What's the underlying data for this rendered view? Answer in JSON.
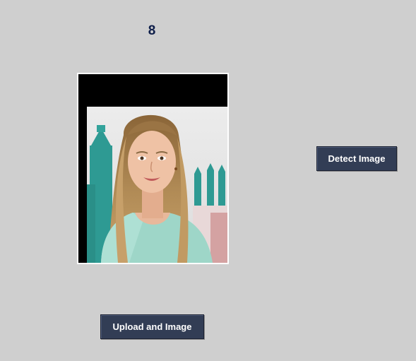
{
  "result": {
    "text": "8"
  },
  "image": {
    "alt": "Uploaded photo"
  },
  "buttons": {
    "detect_label": "Detect Image",
    "upload_label": "Upload and Image"
  },
  "colors": {
    "background": "#cfcfcf",
    "button": "#323d55",
    "result_text": "#0f1f4a"
  }
}
